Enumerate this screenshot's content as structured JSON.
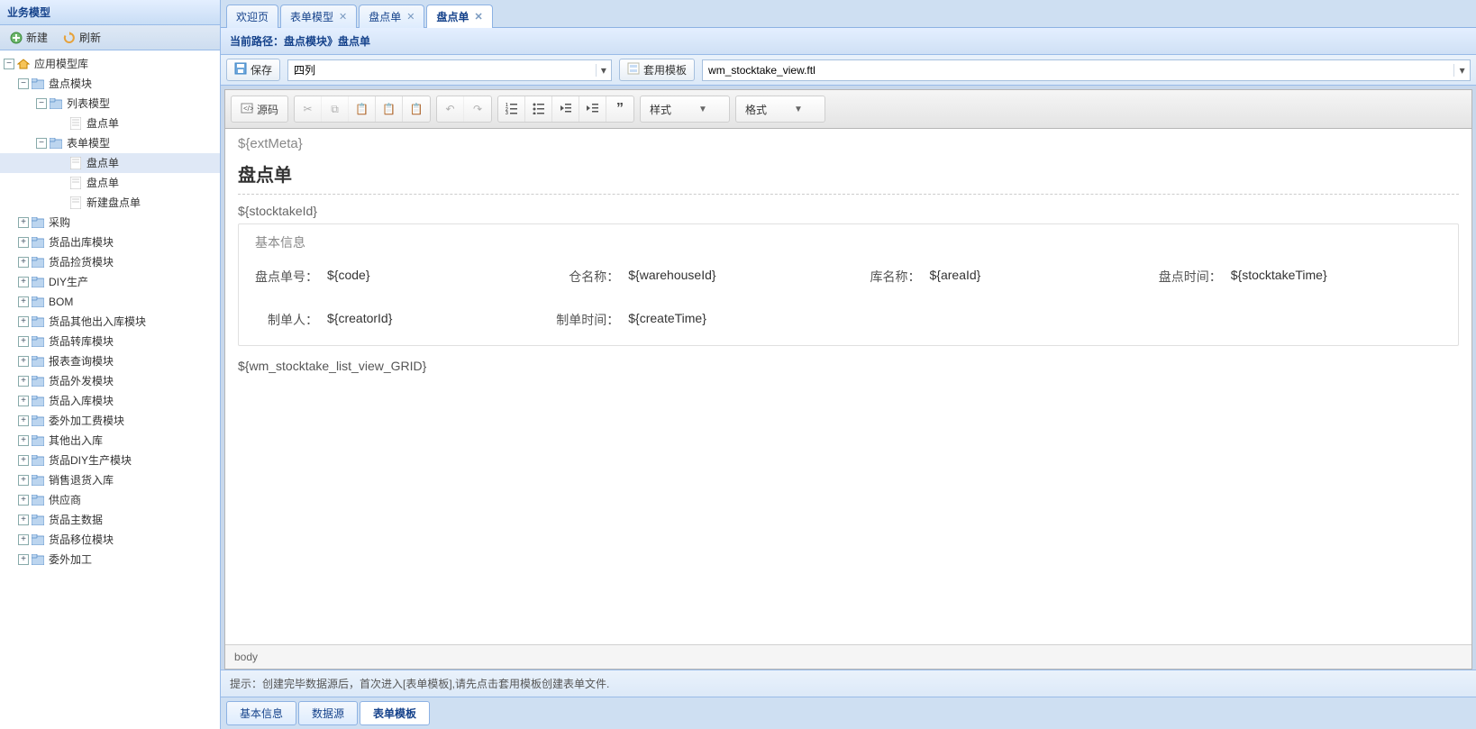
{
  "left": {
    "title": "业务模型",
    "new_btn": "新建",
    "refresh_btn": "刷新",
    "tree": {
      "root": "应用模型库",
      "module": "盘点模块",
      "list_model": "列表模型",
      "list_item1": "盘点单",
      "form_model": "表单模型",
      "form_item1": "盘点单",
      "form_item2": "盘点单",
      "form_item3": "新建盘点单",
      "others": [
        "采购",
        "货品出库模块",
        "货品捡货模块",
        "DIY生产",
        "BOM",
        "货品其他出入库模块",
        "货品转库模块",
        "报表查询模块",
        "货品外发模块",
        "货品入库模块",
        "委外加工费模块",
        "其他出入库",
        "货品DIY生产模块",
        "销售退货入库",
        "供应商",
        "货品主数据",
        "货品移位模块",
        "委外加工"
      ]
    }
  },
  "tabs": {
    "t1": "欢迎页",
    "t2": "表单模型",
    "t3": "盘点单",
    "t4": "盘点单"
  },
  "crumb": "当前路径：盘点模块》盘点单",
  "toolbar": {
    "save": "保存",
    "columns_value": "四列",
    "apply_template": "套用模板",
    "template_value": "wm_stocktake_view.ftl"
  },
  "ck": {
    "source": "源码",
    "style": "样式",
    "format": "格式"
  },
  "doc": {
    "extMeta": "${extMeta}",
    "title": "盘点单",
    "stocktakeId": "${stocktakeId}",
    "legend": "基本信息",
    "fields": {
      "code_l": "盘点单号：",
      "code_v": "${code}",
      "wh_l": "仓名称：",
      "wh_v": "${warehouseId}",
      "area_l": "库名称：",
      "area_v": "${areaId}",
      "time_l": "盘点时间：",
      "time_v": "${stocktakeTime}",
      "creator_l": "制单人：",
      "creator_v": "${creatorId}",
      "ctime_l": "制单时间：",
      "ctime_v": "${createTime}"
    },
    "grid": "${wm_stocktake_list_view_GRID}"
  },
  "pathbar": "body",
  "hint": "提示：创建完毕数据源后，首次进入[表单模板],请先点击套用模板创建表单文件.",
  "bottom_tabs": {
    "t1": "基本信息",
    "t2": "数据源",
    "t3": "表单模板"
  }
}
